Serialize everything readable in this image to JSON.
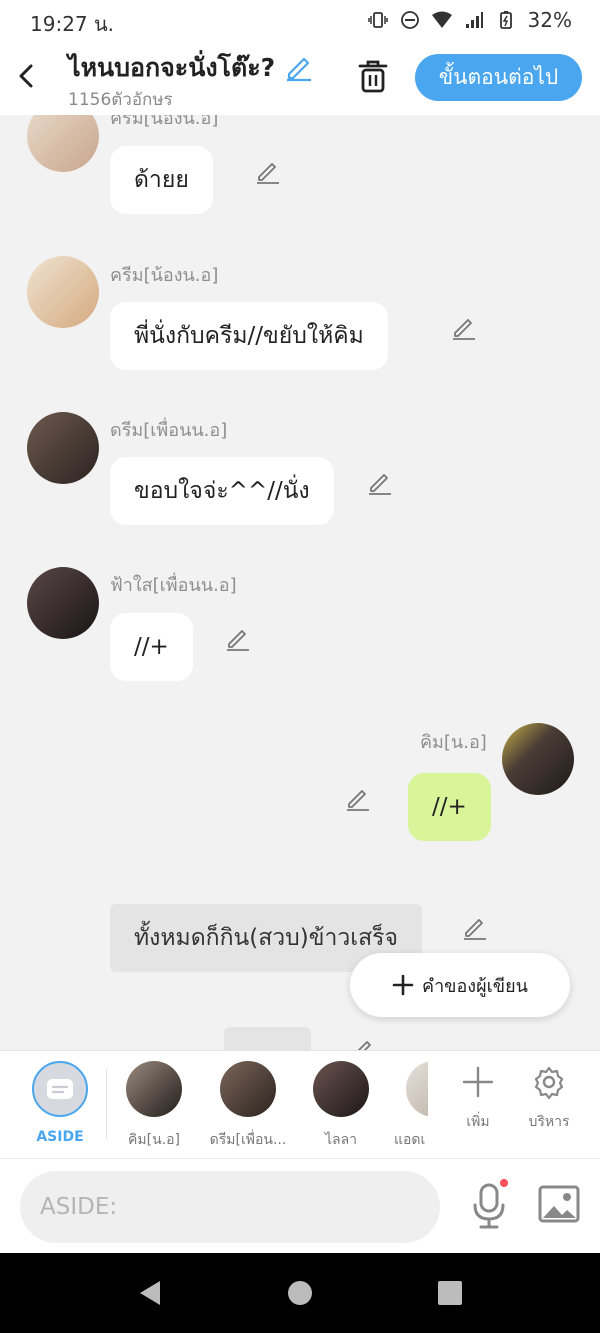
{
  "status": {
    "time": "19:27 น.",
    "battery": "32%"
  },
  "header": {
    "title": "ไหนบอกจะนั่งโต๊ะ?",
    "subtitle": "1156ตัวอักษร",
    "next_label": "ขั้นตอนต่อไป",
    "accent": "#4aa6ee"
  },
  "messages": [
    {
      "name": "ครีม[น้องน.อ]",
      "text": "ด้ายย",
      "side": "left",
      "avatar_color": "#d8b7a3"
    },
    {
      "name": "ครีม[น้องน.อ]",
      "text": "พี่นั่งกับครีม//ขยับให้คิม",
      "side": "left",
      "avatar_color": "#d8b7a3"
    },
    {
      "name": "ดรีม[เพื่อนน.อ]",
      "text": "ขอบใจจ่ะ^^//นั่ง",
      "side": "left",
      "avatar_color": "#4b3a36"
    },
    {
      "name": "ฟ้าใส[เพื่อนน.อ]",
      "text": "//+",
      "side": "left",
      "avatar_color": "#2c2222"
    },
    {
      "name": "คิม[น.อ]",
      "text": "//+",
      "side": "right",
      "avatar_color": "#3b3533"
    },
    {
      "name": "",
      "text": "ทั้งหมดก็กิน(สวบ)ข้าวเสร็จ",
      "side": "narration"
    }
  ],
  "fab": {
    "label": "คำของผู้เขียน"
  },
  "characters": [
    {
      "label": "ASIDE",
      "active": true
    },
    {
      "label": "คิม[น.อ]"
    },
    {
      "label": "ดรีม[เพื่อน..."
    },
    {
      "label": "ไลลา"
    },
    {
      "label": "แอดเ"
    }
  ],
  "tools": {
    "add_label": "เพิ่ม",
    "manage_label": "บริหาร"
  },
  "input": {
    "placeholder": "ASIDE:"
  },
  "colors": {
    "mine_bubble": "#d9f59a",
    "narration_bubble": "#e4e4e5",
    "mic_dot": "#ff4d5a"
  }
}
